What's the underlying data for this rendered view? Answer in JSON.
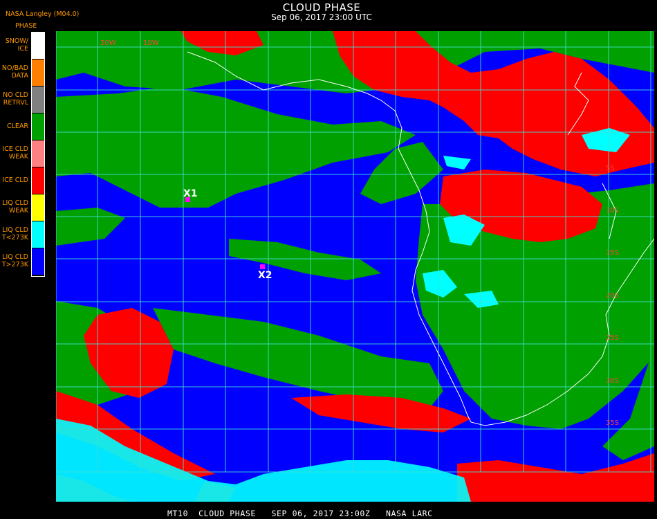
{
  "header": {
    "title": "CLOUD PHASE",
    "subtitle": "Sep 06, 2017 23:00 UTC",
    "credit": "NASA Langley (M04.0)"
  },
  "legend": {
    "title": "PHASE",
    "items": [
      {
        "line1": "SNOW/",
        "line2": "ICE",
        "color": "#ffffff"
      },
      {
        "line1": "NO/BAD",
        "line2": "DATA",
        "color": "#ff8000"
      },
      {
        "line1": "NO CLD",
        "line2": "RETRVL",
        "color": "#808080"
      },
      {
        "line1": "CLEAR",
        "line2": "",
        "color": "#00a000"
      },
      {
        "line1": "ICE CLD",
        "line2": "WEAK",
        "color": "#ff8080"
      },
      {
        "line1": "ICE CLD",
        "line2": "",
        "color": "#ff0000"
      },
      {
        "line1": "LIQ CLD",
        "line2": "WEAK",
        "color": "#ffff00"
      },
      {
        "line1": "LIQ CLD",
        "line2": "T<273K",
        "color": "#00ffff"
      },
      {
        "line1": "LIQ CLD",
        "line2": "T>273K",
        "color": "#0000ff"
      }
    ]
  },
  "map": {
    "markers": [
      {
        "label": "X1",
        "color": "#ff00ff"
      },
      {
        "label": "X2",
        "color": "#ff00ff"
      }
    ],
    "latitude_labels": [
      "5S",
      "10S",
      "15S",
      "20S",
      "25S",
      "30S",
      "35S"
    ],
    "longitude_labels": [
      "20W",
      "10W"
    ],
    "grid_color": "#40e0d0",
    "coast_color": "#ffffff"
  },
  "footer": {
    "text": "MT10  CLOUD PHASE   SEP 06, 2017 23:00Z   NASA LARC"
  }
}
